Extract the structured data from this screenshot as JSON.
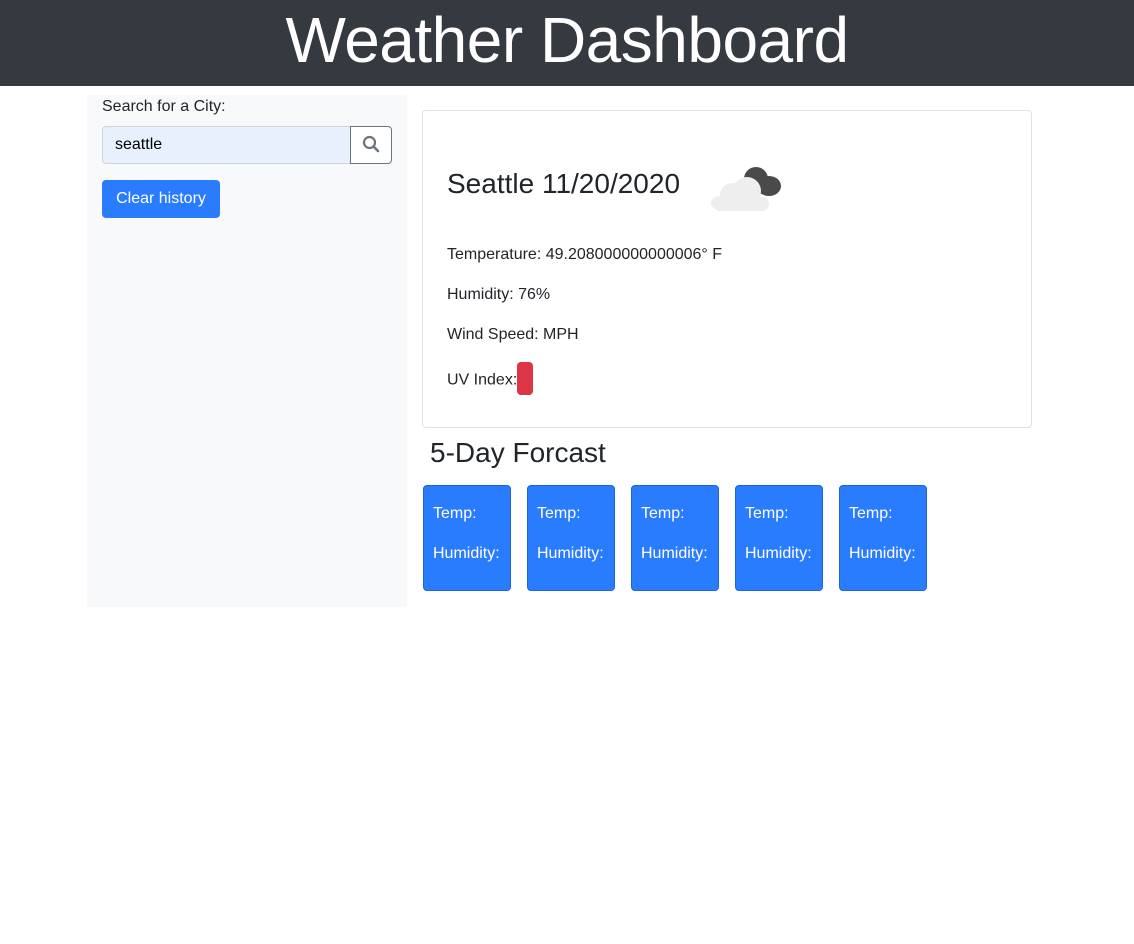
{
  "header": {
    "title": "Weather Dashboard"
  },
  "sidebar": {
    "search_label": "Search for a City:",
    "search_value": "seattle",
    "search_icon": "search-icon",
    "clear_label": "Clear history"
  },
  "current": {
    "title": "Seattle 11/20/2020",
    "icon": "cloud-icon",
    "temperature": "Temperature: 49.208000000000006° F",
    "humidity": "Humidity: 76%",
    "wind": "Wind Speed: MPH",
    "uv_label": "UV Index:",
    "uv_color": "#dc3545"
  },
  "forecast": {
    "heading": "5-Day Forcast",
    "cards": [
      {
        "temp": "Temp:",
        "humidity": "Humidity:"
      },
      {
        "temp": "Temp:",
        "humidity": "Humidity:"
      },
      {
        "temp": "Temp:",
        "humidity": "Humidity:"
      },
      {
        "temp": "Temp:",
        "humidity": "Humidity:"
      },
      {
        "temp": "Temp:",
        "humidity": "Humidity:"
      }
    ],
    "card_color": "#2a7cff"
  }
}
